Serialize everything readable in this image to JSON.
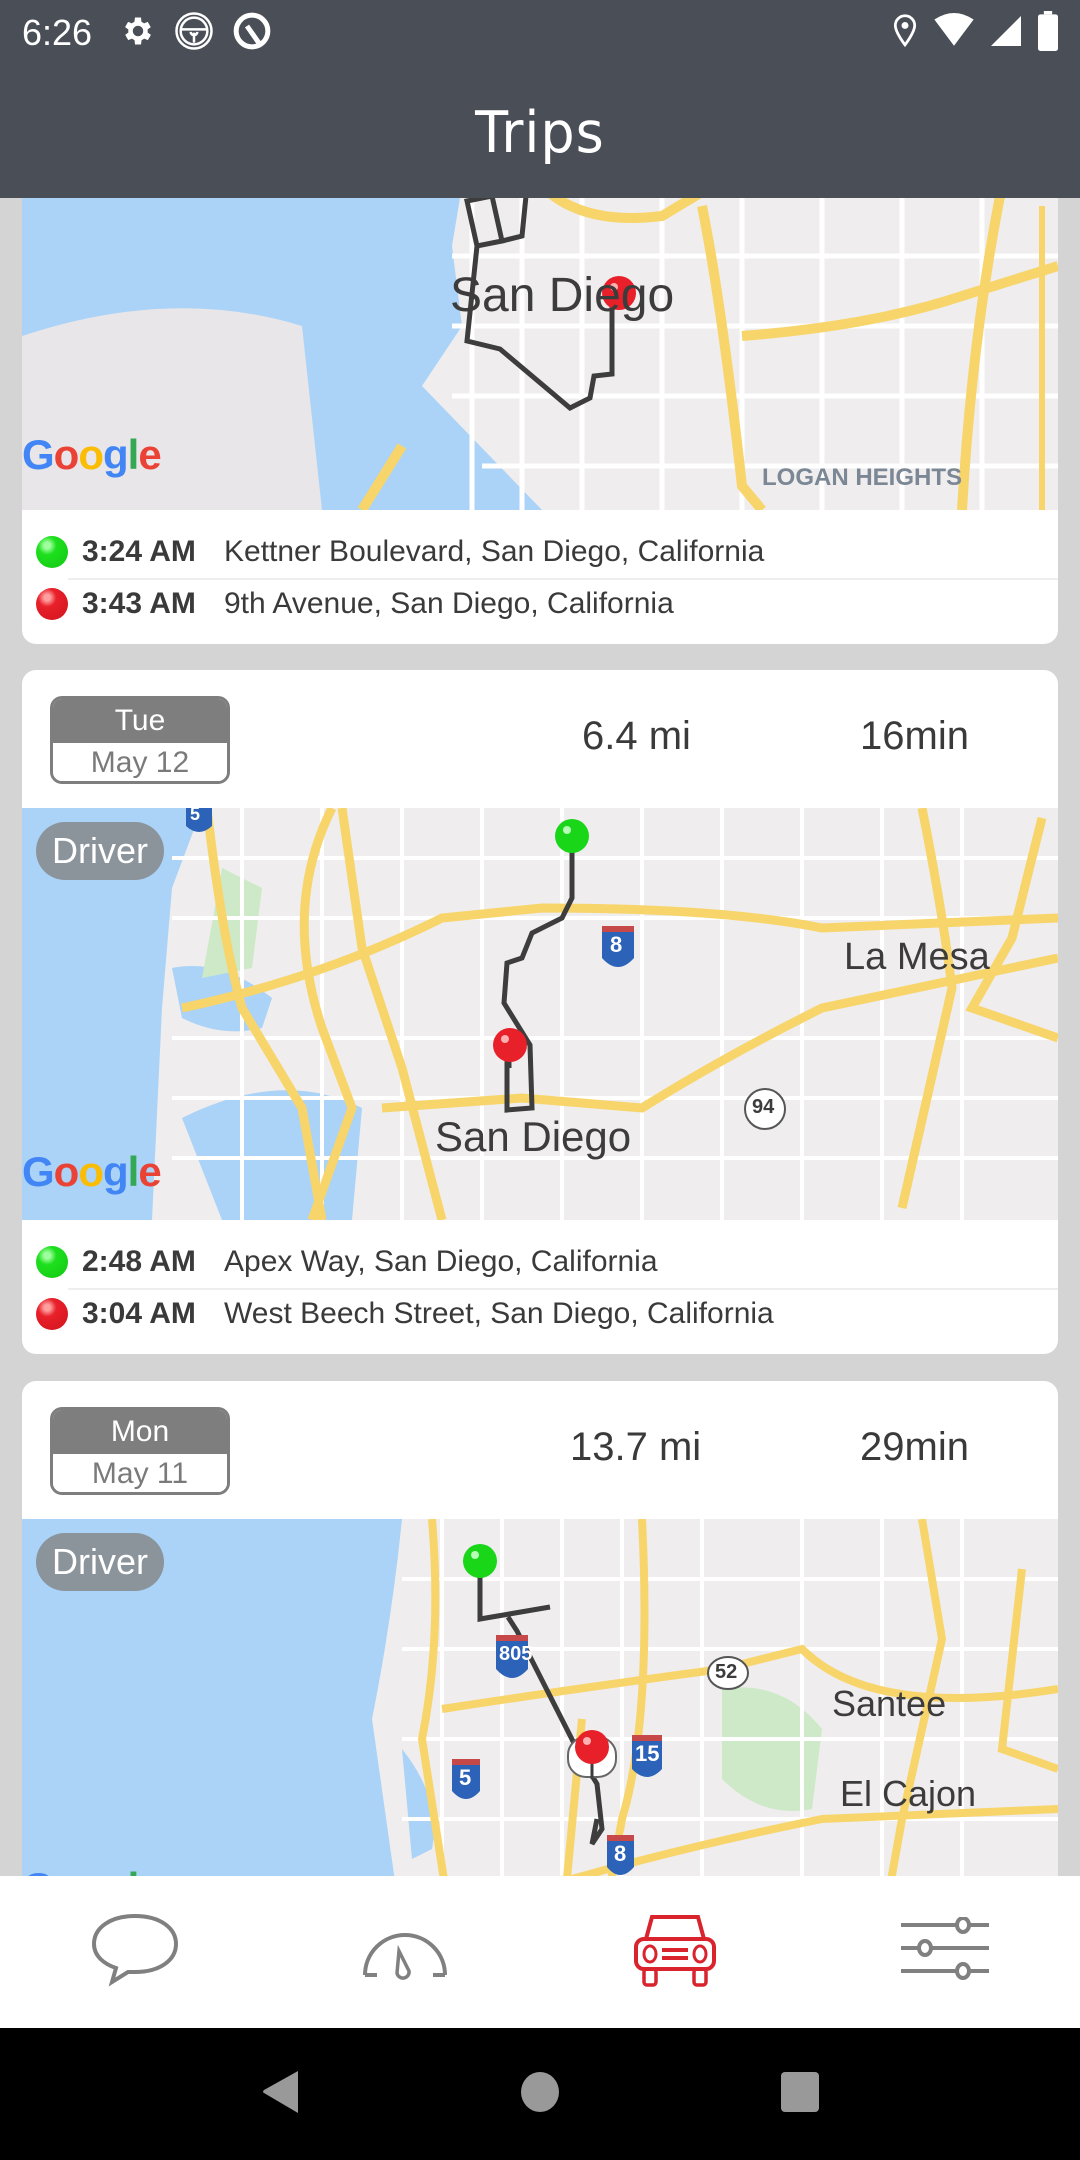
{
  "status_bar": {
    "time": "6:26",
    "left_icons": [
      "gear-icon",
      "steering-wheel-icon",
      "q-app-icon"
    ],
    "right_icons": [
      "location-icon",
      "wifi-icon",
      "signal-icon",
      "battery-icon"
    ]
  },
  "app_bar": {
    "title": "Trips"
  },
  "colors": {
    "header_bg": "#4a4e57",
    "accent": "#d9232d",
    "start_dot": "#1ee01e",
    "end_dot": "#e8202a",
    "badge_gray": "#7e7e7e"
  },
  "trips": [
    {
      "partial": true,
      "map": {
        "labels": [
          "San Diego",
          "LOGAN HEIGHTS"
        ],
        "attribution": "Google"
      },
      "stops": [
        {
          "type": "start",
          "time": "3:24 AM",
          "address": "Kettner Boulevard, San Diego, California"
        },
        {
          "type": "end",
          "time": "3:43 AM",
          "address": "9th Avenue, San Diego, California"
        }
      ]
    },
    {
      "day": "Tue",
      "date": "May 12",
      "distance": "6.4 mi",
      "duration": "16min",
      "role": "Driver",
      "map": {
        "labels": [
          "La Mesa",
          "San Diego"
        ],
        "shields": [
          "5",
          "8",
          "94"
        ],
        "attribution": "Google"
      },
      "stops": [
        {
          "type": "start",
          "time": "2:48 AM",
          "address": "Apex Way, San Diego, California"
        },
        {
          "type": "end",
          "time": "3:04 AM",
          "address": "West Beech Street, San Diego, California"
        }
      ]
    },
    {
      "day": "Mon",
      "date": "May 11",
      "distance": "13.7 mi",
      "duration": "29min",
      "role": "Driver",
      "map": {
        "labels": [
          "Santee",
          "El Cajon"
        ],
        "shields": [
          "805",
          "52",
          "15",
          "5",
          "8"
        ],
        "attribution": "Google"
      }
    }
  ],
  "bottom_nav": [
    {
      "name": "messages",
      "icon": "chat-bubble-icon",
      "active": false
    },
    {
      "name": "dashboard",
      "icon": "speedometer-icon",
      "active": false
    },
    {
      "name": "trips",
      "icon": "car-icon",
      "active": true
    },
    {
      "name": "settings",
      "icon": "sliders-icon",
      "active": false
    }
  ],
  "system_nav": [
    "back",
    "home",
    "recents"
  ]
}
